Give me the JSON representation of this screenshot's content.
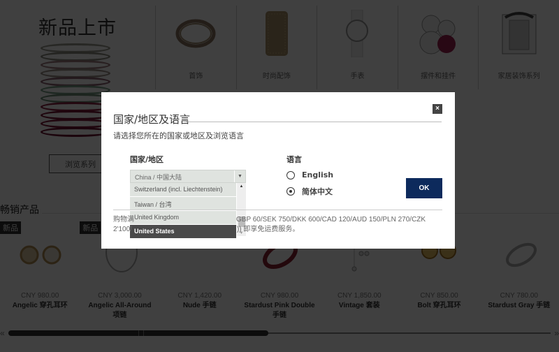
{
  "hero": {
    "title": "新品上市",
    "browse_button": "浏览系列"
  },
  "categories": [
    {
      "label": "首饰",
      "icon": "bracelet-icon"
    },
    {
      "label": "时尚配饰",
      "icon": "phone-case-icon"
    },
    {
      "label": "手表",
      "icon": "watch-icon"
    },
    {
      "label": "摆件和挂件",
      "icon": "teddy-bear-icon"
    },
    {
      "label": "家居装饰系列",
      "icon": "home-decor-icon"
    }
  ],
  "bestsellers": {
    "title": "畅销产品",
    "badge": "新品",
    "products": [
      {
        "price": "CNY 980.00",
        "name": "Angelic 穿孔耳环",
        "badge": true
      },
      {
        "price": "CNY 3,000.00",
        "name": "Angelic All-Around 项链",
        "badge": true
      },
      {
        "price": "CNY 1,420.00",
        "name": "Nude 手链",
        "badge": false
      },
      {
        "price": "CNY 980.00",
        "name": "Stardust Pink Double 手链",
        "badge": false
      },
      {
        "price": "CNY 1,850.00",
        "name": "Vintage 套装",
        "badge": false
      },
      {
        "price": "CNY 850.00",
        "name": "Bolt 穿孔耳环",
        "badge": false
      },
      {
        "price": "CNY 780.00",
        "name": "Stardust Gray 手链",
        "badge": false
      }
    ],
    "scroll_left": "«",
    "scroll_right": "»",
    "scroll_position_fraction": 0.48
  },
  "modal": {
    "title": "国家/地区及语言",
    "close_label": "×",
    "subtitle": "请选择您所在的国家或地区及浏览语言",
    "country_label": "国家/地区",
    "selected_country": "China / 中国大陆",
    "dropdown_options": [
      {
        "label": "Switzerland (incl. Liechtenstein)",
        "selected": false
      },
      {
        "label": "Taiwan / 台湾",
        "selected": false
      },
      {
        "label": "United Kingdom",
        "selected": false
      },
      {
        "label": "United States",
        "selected": true
      }
    ],
    "language_label": "语言",
    "languages": [
      {
        "label": "English",
        "checked": false
      },
      {
        "label": "简体中文",
        "checked": true
      }
    ],
    "ok_label": "OK",
    "shipping_line1_start": "购物满",
    "shipping_line1_end": "GBP 60/SEK 750/DKK 600/CAD 120/AUD 150/PLN 270/CZK",
    "shipping_line2_start": "2'100/",
    "shipping_line2_end": ")) 即享免运费服务。"
  },
  "colors": {
    "ok_button": "#0d2a5c",
    "overlay": "#000000",
    "selected_option": "#4a4a4a"
  }
}
